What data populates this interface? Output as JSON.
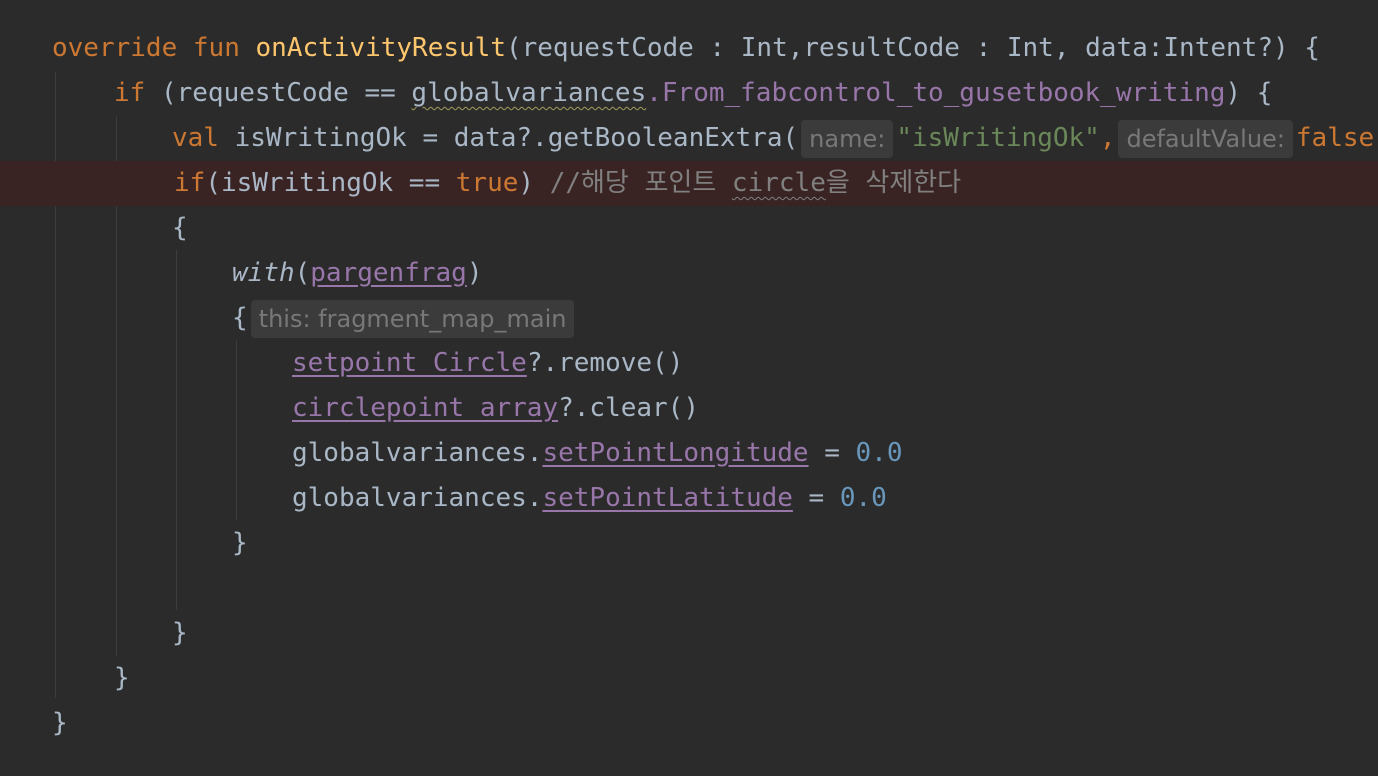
{
  "lines": {
    "l1": {
      "kw_override": "override",
      "kw_fun": "fun",
      "fn_name": "onActivityResult",
      "params": "(requestCode : Int,resultCode : Int, data:Intent?) {"
    },
    "l2": {
      "kw_if": "if",
      "pre": " (requestCode == ",
      "obj": "globalvariances",
      "prop": ".From_fabcontrol_to_gusetbook_writing",
      "post": ") {"
    },
    "l3": {
      "kw_val": "val",
      "pre": " isWritingOk = data?.getBooleanExtra(",
      "hint_name": "name:",
      "str_key": "\"isWritingOk\"",
      "comma": ",",
      "hint_default": "defaultValue:",
      "kw_false": "false",
      "post": ")"
    },
    "l4": {
      "kw_if": "if",
      "mid": "(isWritingOk == ",
      "kw_true": "true",
      "close": ") ",
      "comment_pre": "//해당 포인트 ",
      "comment_circle": "circle",
      "comment_post": "을 삭제한다"
    },
    "l5": {
      "text": "{"
    },
    "l6": {
      "with": "with",
      "open": "(",
      "arg": "pargenfrag",
      "close": ")"
    },
    "l7": {
      "brace": "{",
      "hint": "this: fragment_map_main"
    },
    "l8": {
      "prop": "setpoint_Circle",
      "rest": "?.remove()"
    },
    "l9": {
      "prop": "circlepoint_array",
      "rest": "?.clear()"
    },
    "l10": {
      "obj": "globalvariances.",
      "prop": "setPointLongitude",
      "eq": " = ",
      "num": "0.0"
    },
    "l11": {
      "obj": "globalvariances.",
      "prop": "setPointLatitude",
      "eq": " = ",
      "num": "0.0"
    },
    "l12": {
      "text": "}"
    },
    "l14": {
      "text": "}"
    },
    "l15": {
      "text": "}"
    },
    "l16": {
      "text": "}"
    }
  },
  "colors": {
    "background": "#2b2b2b",
    "keyword": "#cc7832",
    "function": "#ffc66d",
    "string": "#6a8759",
    "number": "#6897bb",
    "property": "#9876aa",
    "comment": "#808080",
    "plain": "#a9b7c6",
    "current_line": "#3a2323"
  }
}
